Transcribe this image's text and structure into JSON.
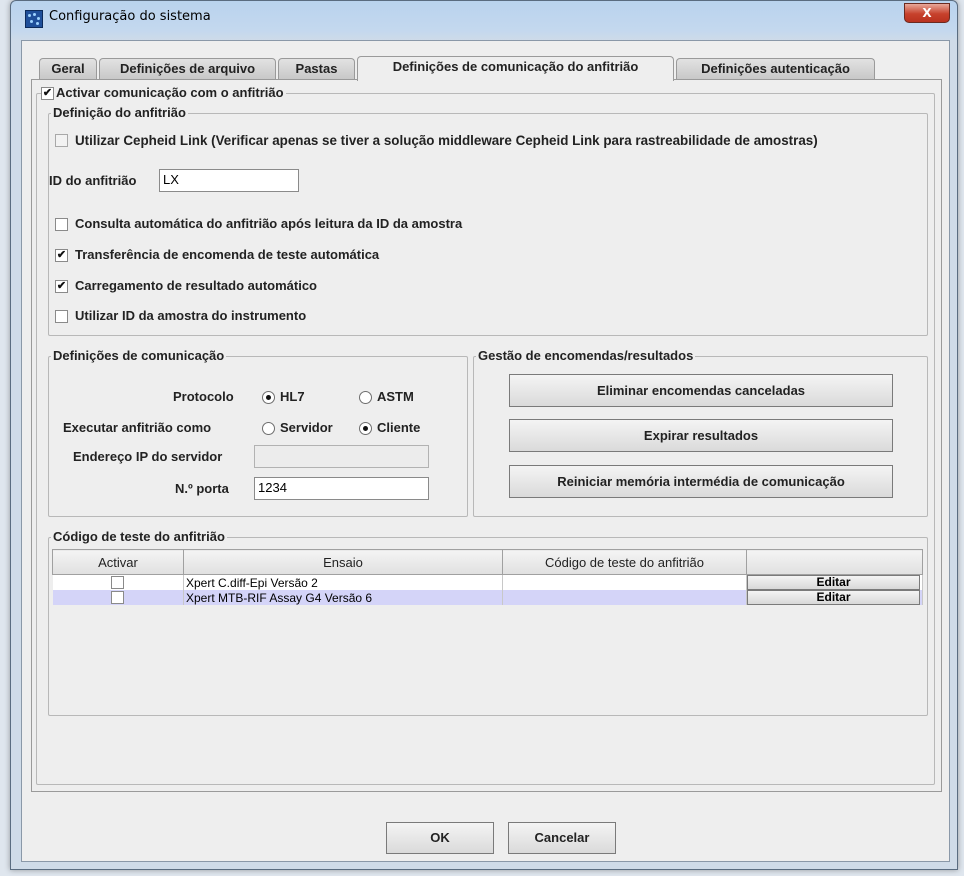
{
  "window": {
    "title": "Configuração do sistema",
    "close_glyph": "X",
    "icon": "app-icon"
  },
  "tabs": [
    {
      "label": "Geral"
    },
    {
      "label": "Definições de arquivo"
    },
    {
      "label": "Pastas"
    },
    {
      "label": "Definições de comunicação do anfitrião",
      "active": true
    },
    {
      "label": "Definições autenticação"
    }
  ],
  "host_comm": {
    "enable_label": "Activar comunicação com o anfitrião",
    "enabled": true,
    "host_def": {
      "legend": "Definição do anfitrião",
      "cepheid_link_label": "Utilizar Cepheid Link (Verificar apenas se tiver a solução middleware Cepheid Link para rastreabilidade de amostras)",
      "cepheid_link_checked": false,
      "host_id_label": "ID do anfitrião",
      "host_id_value": "LX",
      "options": [
        {
          "label": "Consulta automática do anfitrião após leitura da ID da amostra",
          "checked": false
        },
        {
          "label": "Transferência de encomenda de teste automática",
          "checked": true
        },
        {
          "label": "Carregamento de resultado automático",
          "checked": true
        },
        {
          "label": "Utilizar ID da amostra do instrumento",
          "checked": false
        }
      ]
    },
    "comm_def": {
      "legend": "Definições de comunicação",
      "protocol_label": "Protocolo",
      "protocol_options": [
        "HL7",
        "ASTM"
      ],
      "protocol_selected": "HL7",
      "run_as_label": "Executar anfitrião como",
      "run_as_options": [
        "Servidor",
        "Cliente"
      ],
      "run_as_selected": "Cliente",
      "server_ip_label": "Endereço IP do servidor",
      "server_ip_value": "",
      "port_label": "N.º porta",
      "port_value": "1234"
    },
    "orders": {
      "legend": "Gestão de encomendas/resultados",
      "delete_cancelled_label": "Eliminar encomendas canceladas",
      "expire_results_label": "Expirar resultados",
      "reset_buffer_label": "Reiniciar memória intermédia de comunicação"
    },
    "test_codes": {
      "legend": "Código de teste do anfitrião",
      "columns": [
        "Activar",
        "Ensaio",
        "Código de teste do anfitrião",
        ""
      ],
      "rows": [
        {
          "assay": "Xpert C.diff-Epi Versão 2",
          "code": "",
          "checked": false,
          "edit_label": "Editar",
          "selected": false
        },
        {
          "assay": "Xpert MTB-RIF Assay G4 Versão 6",
          "code": "",
          "checked": false,
          "edit_label": "Editar",
          "selected": true
        }
      ]
    }
  },
  "footer": {
    "ok_label": "OK",
    "cancel_label": "Cancelar"
  }
}
